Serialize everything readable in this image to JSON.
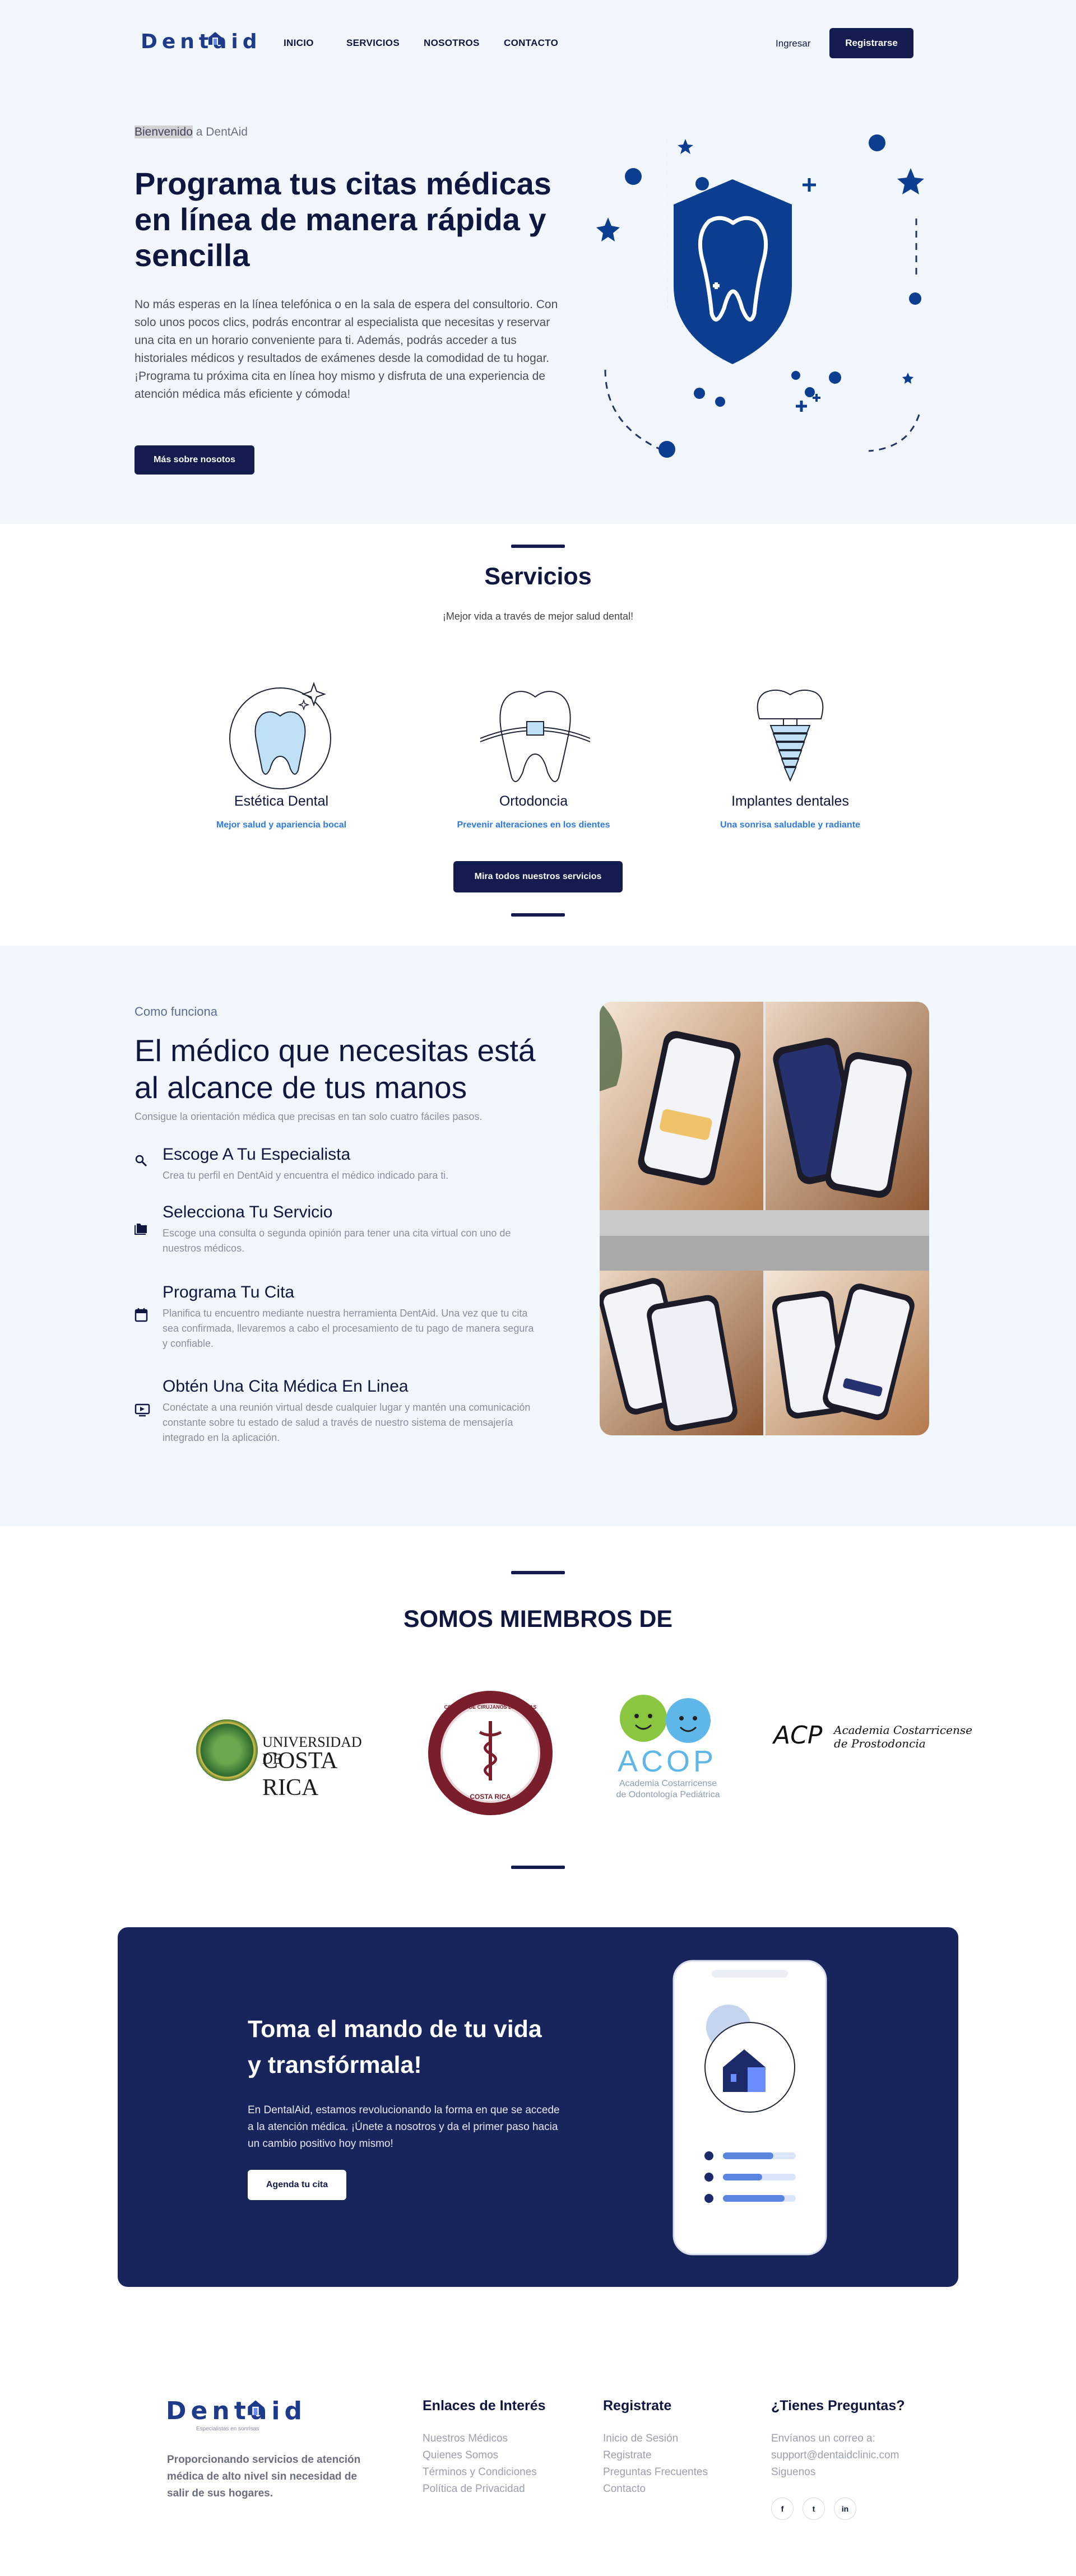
{
  "header": {
    "logo": "Dentaid",
    "nav": [
      "INICIO",
      "SERVICIOS",
      "NOSOTROS",
      "CONTACTO"
    ],
    "login": "Ingresar",
    "register": "Registrarse"
  },
  "hero": {
    "eyebrow_highlight": "Bienvenido",
    "eyebrow_rest": " a DentAid",
    "title": "Programa tus citas médicas en línea de manera rápida y sencilla",
    "text": "No más esperas en la línea telefónica o en la sala de espera del consultorio. Con solo unos pocos clics, podrás encontrar al especialista que necesitas y reservar una cita en un horario conveniente para ti. Además, podrás acceder a tus historiales médicos y resultados de exámenes desde la comodidad de tu hogar. ¡Programa tu próxima cita en línea hoy mismo y disfruta de una experiencia de atención médica más eficiente y cómoda!",
    "button": "Más sobre nosotos"
  },
  "services": {
    "title": "Servicios",
    "subtitle": "¡Mejor vida a través de mejor salud dental!",
    "items": [
      {
        "title": "Estética Dental",
        "subtitle": "Mejor salud y apariencia bocal"
      },
      {
        "title": "Ortodoncia",
        "subtitle": "Prevenir alteraciones en los dientes"
      },
      {
        "title": "Implantes dentales",
        "subtitle": "Una sonrisa saludable y radiante"
      }
    ],
    "button": "Mira todos nuestros servicios"
  },
  "how": {
    "eyebrow": "Como funciona",
    "title": "El médico que necesitas está al alcance de tus manos",
    "subtitle": "Consigue la orientación médica que precisas en tan solo cuatro fáciles pasos.",
    "steps": [
      {
        "icon": "search-icon",
        "title": "Escoge A Tu Especialista",
        "text": "Crea tu perfil en DentAid y encuentra el médico indicado para ti."
      },
      {
        "icon": "folder-icon",
        "title": "Selecciona Tu Servicio",
        "text": "Escoge una consulta o segunda opinión para tener una cita virtual con uno de nuestros médicos."
      },
      {
        "icon": "calendar-icon",
        "title": "Programa Tu Cita",
        "text": "Planifica tu encuentro mediante nuestra herramienta DentAid. Una vez que tu cita sea confirmada, llevaremos a cabo el procesamiento de tu pago de manera segura y confiable."
      },
      {
        "icon": "video-call-icon",
        "title": "Obtén Una Cita Médica En Linea",
        "text": "Conéctate a una reunión virtual desde cualquier lugar y mantén una comunicación constante sobre tu estado de salud a través de nuestro sistema de mensajería integrado en la aplicación."
      }
    ]
  },
  "members": {
    "title": "SOMOS MIEMBROS DE",
    "ucr": [
      "UNIVERSIDAD DE",
      "COSTA RICA"
    ],
    "colegio": [
      "COLEGIO DE CIRUJANOS DENTISTAS",
      "COSTA RICA"
    ],
    "acop": [
      "ACOP",
      "Academia Costarricense",
      "de Odontología Pediátrica"
    ],
    "acp": [
      "ACP",
      "Academia Costarricense",
      "de Prostodoncia"
    ]
  },
  "cta": {
    "title": "Toma el mando de tu vida y transfórmala!",
    "text": "En DentalAid, estamos revolucionando la forma en que se accede a la atención médica. ¡Únete a nosotros y da el primer paso hacia un cambio positivo hoy mismo!",
    "button": "Agenda tu cita"
  },
  "footer": {
    "logo": "Dentaid",
    "tagline": "Especialistas en sonrisas",
    "about": "Proporcionando servicios de atención médica de alto nivel sin necesidad de salir de sus hogares.",
    "col1": {
      "title": "Enlaces de Interés",
      "links": [
        "Nuestros Médicos",
        "Quienes Somos",
        "Términos y Condiciones",
        "Política de Privacidad"
      ]
    },
    "col2": {
      "title": "Registrate",
      "links": [
        "Inicio de Sesión",
        "Registrate",
        "Preguntas Frecuentes",
        "Contacto"
      ]
    },
    "col3": {
      "title": "¿Tienes Preguntas?",
      "lines": [
        "Envíanos un correo a:",
        "support@dentaidclinic.com",
        "Siguenos"
      ],
      "social": [
        "f",
        "t",
        "in"
      ]
    }
  },
  "colors": {
    "navy": "#141c4f",
    "royal": "#0b3d91",
    "accent_blue": "#2f7ae0",
    "light_bg": "#f1f7fd"
  }
}
